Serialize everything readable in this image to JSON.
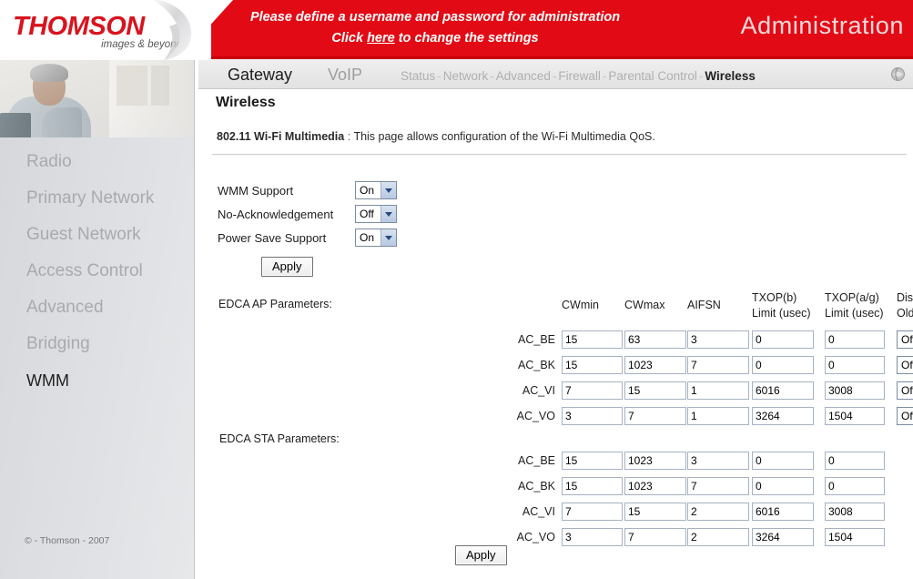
{
  "brand": {
    "logo_text": "THOMSON",
    "logo_tagline": "images & beyond",
    "copyright": "© - Thomson - 2007"
  },
  "banner": {
    "line1": "Please define a username and password for administration",
    "line2_pre": "Click ",
    "line2_link": "here",
    "line2_post": " to change the settings",
    "section_title": "Administration",
    "bg_color": "#e20a14"
  },
  "nav": {
    "primary": [
      {
        "label": "Gateway",
        "active": true
      },
      {
        "label": "VoIP",
        "active": false
      }
    ],
    "sub_items": [
      {
        "label": "Status",
        "active": false
      },
      {
        "label": "Network",
        "active": false
      },
      {
        "label": "Advanced",
        "active": false
      },
      {
        "label": "Firewall",
        "active": false
      },
      {
        "label": "Parental Control",
        "active": false
      },
      {
        "label": "Wireless",
        "active": true
      }
    ],
    "separator": "-",
    "right_icon": "globe-icon"
  },
  "sidebar": {
    "photo_icon": "person-with-laptop-photo",
    "items": [
      {
        "label": "Radio",
        "active": false
      },
      {
        "label": "Primary Network",
        "active": false
      },
      {
        "label": "Guest Network",
        "active": false
      },
      {
        "label": "Access Control",
        "active": false
      },
      {
        "label": "Advanced",
        "active": false
      },
      {
        "label": "Bridging",
        "active": false
      },
      {
        "label": "WMM",
        "active": true
      }
    ]
  },
  "page": {
    "title": "Wireless",
    "section_label": "802.11 Wi-Fi Multimedia",
    "section_colon": ":",
    "section_desc": "This page allows configuration of the Wi-Fi Multimedia QoS."
  },
  "settings": {
    "rows": [
      {
        "label": "WMM Support",
        "value": "On"
      },
      {
        "label": "No-Acknowledgement",
        "value": "Off"
      },
      {
        "label": "Power Save Support",
        "value": "On"
      }
    ],
    "options": [
      "On",
      "Off"
    ],
    "apply_label": "Apply"
  },
  "ap_table": {
    "title": "EDCA AP Parameters:",
    "headers": {
      "cwmin": "CWmin",
      "cwmax": "CWmax",
      "aifsn": "AIFSN",
      "txop_b_l1": "TXOP(b)",
      "txop_b_l2": "Limit (usec)",
      "txop_ag_l1": "TXOP(a/g)",
      "txop_ag_l2": "Limit (usec)",
      "discard_l1": "Discard",
      "discard_l2": "Oldest First"
    },
    "rows": [
      {
        "name": "AC_BE",
        "cwmin": "15",
        "cwmax": "63",
        "aifsn": "3",
        "txop_b": "0",
        "txop_ag": "0",
        "discard": "Off"
      },
      {
        "name": "AC_BK",
        "cwmin": "15",
        "cwmax": "1023",
        "aifsn": "7",
        "txop_b": "0",
        "txop_ag": "0",
        "discard": "Off"
      },
      {
        "name": "AC_VI",
        "cwmin": "7",
        "cwmax": "15",
        "aifsn": "1",
        "txop_b": "6016",
        "txop_ag": "3008",
        "discard": "Off"
      },
      {
        "name": "AC_VO",
        "cwmin": "3",
        "cwmax": "7",
        "aifsn": "1",
        "txop_b": "3264",
        "txop_ag": "1504",
        "discard": "Off"
      }
    ]
  },
  "sta_table": {
    "title": "EDCA STA Parameters:",
    "rows": [
      {
        "name": "AC_BE",
        "cwmin": "15",
        "cwmax": "1023",
        "aifsn": "3",
        "txop_b": "0",
        "txop_ag": "0"
      },
      {
        "name": "AC_BK",
        "cwmin": "15",
        "cwmax": "1023",
        "aifsn": "7",
        "txop_b": "0",
        "txop_ag": "0"
      },
      {
        "name": "AC_VI",
        "cwmin": "7",
        "cwmax": "15",
        "aifsn": "2",
        "txop_b": "6016",
        "txop_ag": "3008"
      },
      {
        "name": "AC_VO",
        "cwmin": "3",
        "cwmax": "7",
        "aifsn": "2",
        "txop_b": "3264",
        "txop_ag": "1504"
      }
    ]
  },
  "footer": {
    "apply_label": "Apply"
  }
}
